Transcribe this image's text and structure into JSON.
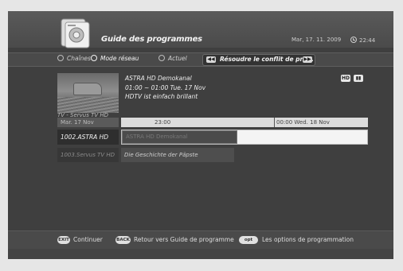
{
  "header": {
    "title": "Guide des programmes",
    "date": "Mar, 17. 11. 2009",
    "time": "22:44",
    "icon": "guide-book-icon"
  },
  "tabs": {
    "options": [
      {
        "label": "Chaînes",
        "selected": false
      },
      {
        "label": "Mode réseau",
        "selected": true
      },
      {
        "label": "Actuel",
        "selected": false
      }
    ],
    "conflict_label": "Résoudre le conflit de pro..."
  },
  "program": {
    "thumbnail_label": "TV - Servus TV HD",
    "channel": "ASTRA HD Demokanal",
    "time": "01:00 ~ 01:00  Tue. 17 Nov",
    "description": "HDTV ist einfach brillant",
    "badges": [
      "HD",
      "▮▮"
    ]
  },
  "timeline": {
    "date": "Mar. 17 Nov",
    "marks": [
      "23:00",
      "00:00 Wed. 18 Nov"
    ]
  },
  "channels": [
    {
      "name": "1002.ASTRA HD",
      "event": "ASTRA HD Demokanal"
    },
    {
      "name": "1003.Servus TV HD",
      "event": "Die Geschichte der Päpste"
    }
  ],
  "footer": {
    "buttons": [
      {
        "key": "EXIT",
        "label": "Continuer"
      },
      {
        "key": "BACK",
        "label": "Retour vers Guide de programme"
      },
      {
        "key": "opt",
        "label": "Les options de programmation"
      }
    ]
  }
}
